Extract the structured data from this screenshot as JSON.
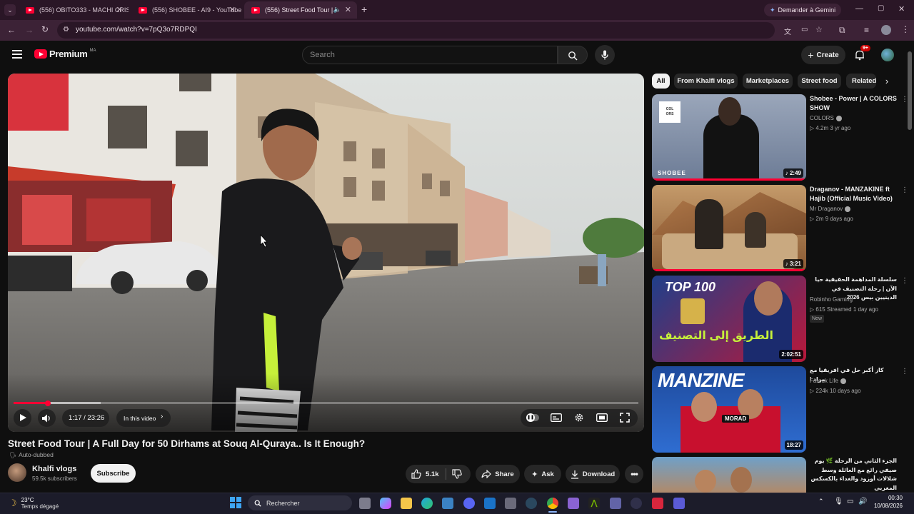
{
  "browser": {
    "tabs": [
      {
        "title": "(556) OBITO333 - MACHI CRIS..."
      },
      {
        "title": "(556) SHOBEE - AI9 - YouTube"
      },
      {
        "title": "(556) Street Food Tour | A F..."
      }
    ],
    "gemini_label": "Demander à Gemini",
    "url": "youtube.com/watch?v=7pQ3o7RDPQI"
  },
  "youtube_header": {
    "logo_text": "Premium",
    "logo_region": "MA",
    "search_placeholder": "Search",
    "create_label": "Create",
    "notif_count": "9+"
  },
  "player": {
    "time": "1:17 / 23:26",
    "in_this_video": "In this video",
    "progress_fraction": 0.055
  },
  "video": {
    "title": "Street Food Tour | A Full Day for 50 Dirhams at Souq Al-Quraya.. Is It Enough?",
    "auto_dubbed": "Auto-dubbed",
    "channel": "Khalfi vlogs",
    "subscribers": "59.5k subscribers",
    "subscribe_label": "Subscribe",
    "likes": "5.1k",
    "share_label": "Share",
    "ask_label": "Ask",
    "download_label": "Download"
  },
  "chips": [
    "All",
    "From Khalfi vlogs",
    "Marketplaces",
    "Street food",
    "Related"
  ],
  "recommendations": [
    {
      "title": "Shobee - Power | A COLORS SHOW",
      "channel": "COLORS",
      "meta": "▷ 4.2m   3 yr ago",
      "duration": "2:49",
      "thumb_text": "SHOBEE",
      "badge": ""
    },
    {
      "title": "Draganov - MANZAKINE ft Hajib (Official Music Video)",
      "channel": "Mr Draganov",
      "meta": "▷ 2m   9 days ago",
      "duration": "3:21",
      "thumb_text": "",
      "badge": ""
    },
    {
      "title": "سلسلة المداهمة الحقيقية حيا الآن | رحلة التصنيف في الدينيين بيس 2026",
      "channel": "Robinho Gaming",
      "meta": "▷ 615   Streamed 1 day ago",
      "duration": "2:02:51",
      "thumb_text": "TOP 100",
      "thumb_text2": "الطريق إلى التصنيف",
      "badge": "New"
    },
    {
      "title": "كاز أكبر حل في افريقيا مع مراد !",
      "channel": "Farouk Life",
      "meta": "▷ 224k   10 days ago",
      "duration": "18:27",
      "thumb_text": "MANZINE",
      "thumb_text2": "MORAD",
      "badge": ""
    },
    {
      "title": "الجزء الثاني من الرحلة 🌿 يوم صيفي رائع مع العائلة وسط شلالات أوزود والغداء بالكسكس المغربي",
      "channel": "",
      "meta": "",
      "duration": "",
      "thumb_text": "",
      "badge": ""
    }
  ],
  "taskbar": {
    "weather_temp": "23°C",
    "weather_desc": "Temps dégagé",
    "search_label": "Rechercher",
    "time": "00:30",
    "date": "10/08/2026"
  },
  "colors": {
    "brand_red": "#ff0033",
    "chrome_bg": "#3c2236",
    "yt_bg": "#0f0f0f"
  }
}
